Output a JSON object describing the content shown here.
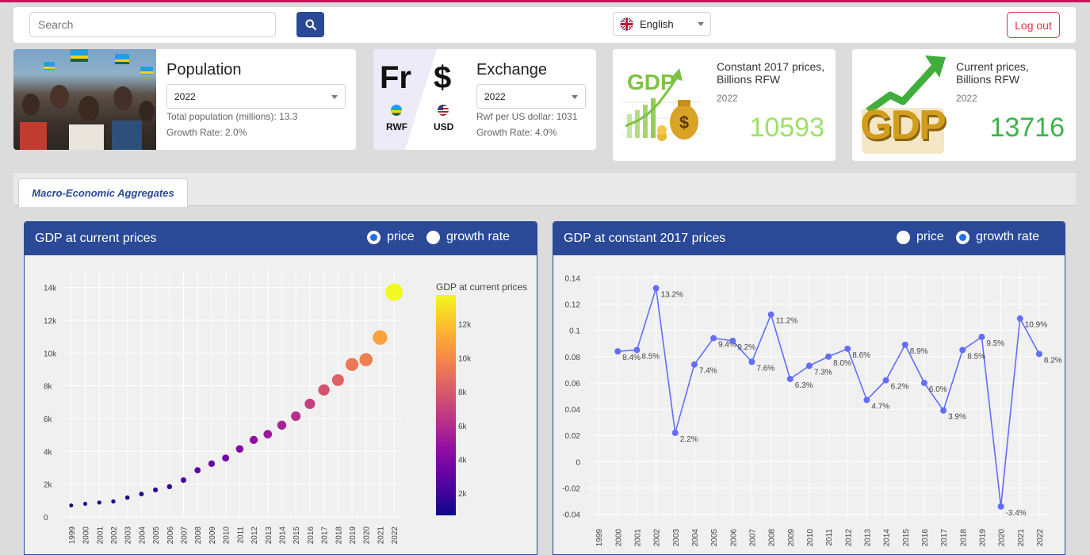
{
  "header": {
    "search_placeholder": "Search",
    "language": "English",
    "logout_label": "Log out"
  },
  "population": {
    "title": "Population",
    "year": "2022",
    "total": "Total population (millions): 13.3",
    "growth": "Growth Rate: 2.0%"
  },
  "exchange": {
    "title": "Exchange",
    "year": "2022",
    "symbol_left": "Fr",
    "symbol_right": "$",
    "cur_left": "RWF",
    "cur_right": "USD",
    "rate": "Rwf per US dollar: 1031",
    "growth": "Growth Rate: 4.0%"
  },
  "gdp_constant": {
    "label": "Constant 2017 prices, Billions RFW",
    "year": "2022",
    "value": "10593",
    "logo_text": "GDP",
    "color": "#9ee06a"
  },
  "gdp_current": {
    "label": "Current prices, Billions RFW",
    "year": "2022",
    "value": "13716",
    "logo_text": "GDP",
    "color": "#3bb54a"
  },
  "tabs": [
    "Macro-Economic Aggregates"
  ],
  "panel1": {
    "title": "GDP at current prices",
    "radio_price": "price",
    "radio_growth": "growth rate",
    "selected": "price"
  },
  "panel2": {
    "title": "GDP at constant 2017 prices",
    "radio_price": "price",
    "radio_growth": "growth rate",
    "selected": "growth rate"
  },
  "colors": {
    "brand": "#2a4a97",
    "danger": "#dc3545",
    "line": "#636efa"
  },
  "chart_data": [
    {
      "type": "scatter",
      "x": [
        "1999",
        "2000",
        "2001",
        "2002",
        "2003",
        "2004",
        "2005",
        "2006",
        "2007",
        "2008",
        "2009",
        "2010",
        "2011",
        "2012",
        "2013",
        "2014",
        "2015",
        "2016",
        "2017",
        "2018",
        "2019",
        "2020",
        "2021",
        "2022"
      ],
      "y": [
        700,
        800,
        880,
        950,
        1180,
        1400,
        1650,
        1850,
        2250,
        2850,
        3250,
        3600,
        4150,
        4700,
        5050,
        5600,
        6150,
        6900,
        7750,
        8350,
        9300,
        9600,
        10950,
        13716
      ],
      "yticks": [
        "0",
        "2k",
        "4k",
        "6k",
        "8k",
        "10k",
        "12k",
        "14k"
      ],
      "ylim": [
        0,
        15000
      ],
      "colorbar_title": "GDP at current prices",
      "colorbar_ticks": [
        "2k",
        "4k",
        "6k",
        "8k",
        "10k",
        "12k"
      ],
      "colorscale": "plasma"
    },
    {
      "type": "line",
      "x": [
        "1999",
        "2000",
        "2001",
        "2002",
        "2003",
        "2004",
        "2005",
        "2006",
        "2007",
        "2008",
        "2009",
        "2010",
        "2011",
        "2012",
        "2013",
        "2014",
        "2015",
        "2016",
        "2017",
        "2018",
        "2019",
        "2020",
        "2021",
        "2022"
      ],
      "y": [
        null,
        0.084,
        0.085,
        0.132,
        0.022,
        0.074,
        0.094,
        0.092,
        0.076,
        0.112,
        0.063,
        0.073,
        0.08,
        0.086,
        0.047,
        0.062,
        0.089,
        0.06,
        0.039,
        0.085,
        0.095,
        -0.034,
        0.109,
        0.082
      ],
      "labels": [
        "",
        "8.4%",
        "8.5%",
        "13.2%",
        "2.2%",
        "7.4%",
        "9.4%",
        "9.2%",
        "7.6%",
        "11.2%",
        "6.3%",
        "7.3%",
        "8.0%",
        "8.6%",
        "4.7%",
        "6.2%",
        "8.9%",
        "6.0%",
        "3.9%",
        "8.5%",
        "9.5%",
        "-3.4%",
        "10.9%",
        "8.2%"
      ],
      "yticks": [
        "-0.04",
        "-0.02",
        "0",
        "0.02",
        "0.04",
        "0.06",
        "0.08",
        "0.1",
        "0.12",
        "0.14"
      ],
      "ylim": [
        -0.045,
        0.145
      ]
    }
  ]
}
